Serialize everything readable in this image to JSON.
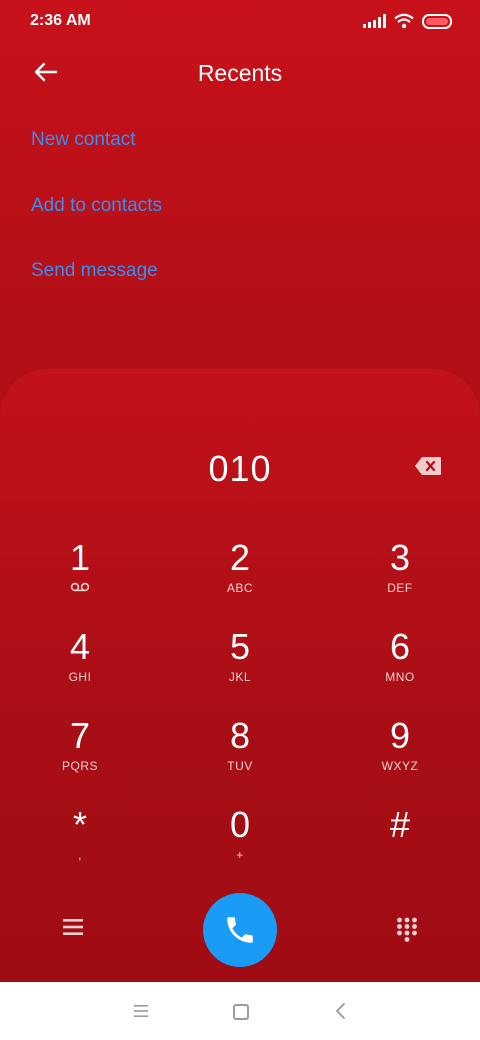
{
  "status_bar": {
    "time": "2:36 AM"
  },
  "header": {
    "title": "Recents",
    "back_icon": "back-arrow-icon"
  },
  "actions": {
    "new_contact": "New contact",
    "add_to_contacts": "Add to contacts",
    "send_message": "Send message"
  },
  "dialpad": {
    "number": "010",
    "keys": [
      {
        "digit": "1",
        "letters": "voicemail"
      },
      {
        "digit": "2",
        "letters": "ABC"
      },
      {
        "digit": "3",
        "letters": "DEF"
      },
      {
        "digit": "4",
        "letters": "GHI"
      },
      {
        "digit": "5",
        "letters": "JKL"
      },
      {
        "digit": "6",
        "letters": "MNO"
      },
      {
        "digit": "7",
        "letters": "PQRS"
      },
      {
        "digit": "8",
        "letters": "TUV"
      },
      {
        "digit": "9",
        "letters": "WXYZ"
      },
      {
        "digit": "*",
        "letters": ","
      },
      {
        "digit": "0",
        "letters": "+"
      },
      {
        "digit": "#",
        "letters": ""
      }
    ]
  },
  "colors": {
    "accent_link": "#3b8df0",
    "call_button": "#1a9bf5",
    "background": "#b30f17"
  }
}
